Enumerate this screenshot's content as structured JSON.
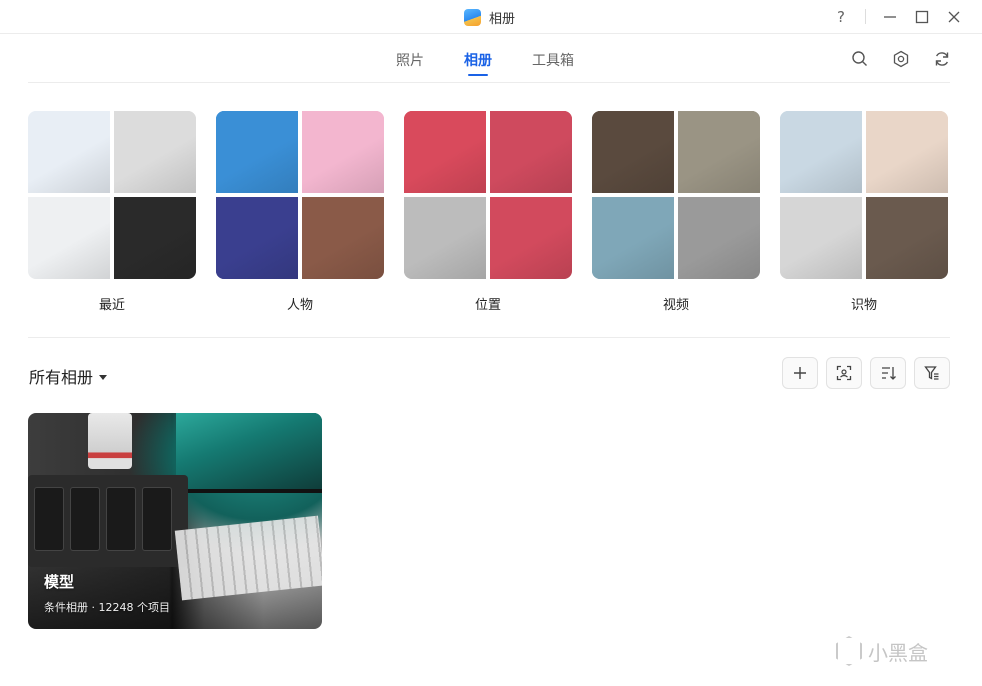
{
  "window": {
    "title": "相册",
    "controls": {
      "help": "?",
      "minimize": "—",
      "maximize": "☐",
      "close": "✕"
    }
  },
  "tabs": [
    {
      "label": "照片",
      "active": false
    },
    {
      "label": "相册",
      "active": true
    },
    {
      "label": "工具箱",
      "active": false
    }
  ],
  "toolbar_icons": [
    "search-icon",
    "settings-icon",
    "refresh-icon"
  ],
  "categories": [
    {
      "label": "最近",
      "tiles": [
        "#e8eef5",
        "#dcdcdc",
        "#eef0f2",
        "#2a2a2a"
      ]
    },
    {
      "label": "人物",
      "tiles": [
        "#3a8fd6",
        "#f3b6cf",
        "#3a3f8f",
        "#8a5a48"
      ]
    },
    {
      "label": "位置",
      "tiles": [
        "#d94a5c",
        "#cf4a5e",
        "#bcbcbc",
        "#d24a5d"
      ]
    },
    {
      "label": "视频",
      "tiles": [
        "#5a4a3e",
        "#9a9484",
        "#7fa7b8",
        "#9a9a9a"
      ]
    },
    {
      "label": "识物",
      "tiles": [
        "#c9d8e3",
        "#e9d6c8",
        "#d6d6d6",
        "#6a5a4e"
      ]
    }
  ],
  "all_albums": {
    "label": "所有相册"
  },
  "actions": [
    "add-icon",
    "face-scan-icon",
    "sort-icon",
    "filter-icon"
  ],
  "album": {
    "title": "模型",
    "subtitle": "条件相册 · 12248 个项目"
  },
  "watermark": {
    "text": "小黑盒"
  },
  "colors": {
    "accent": "#1a62e6",
    "divider": "#ececec"
  }
}
